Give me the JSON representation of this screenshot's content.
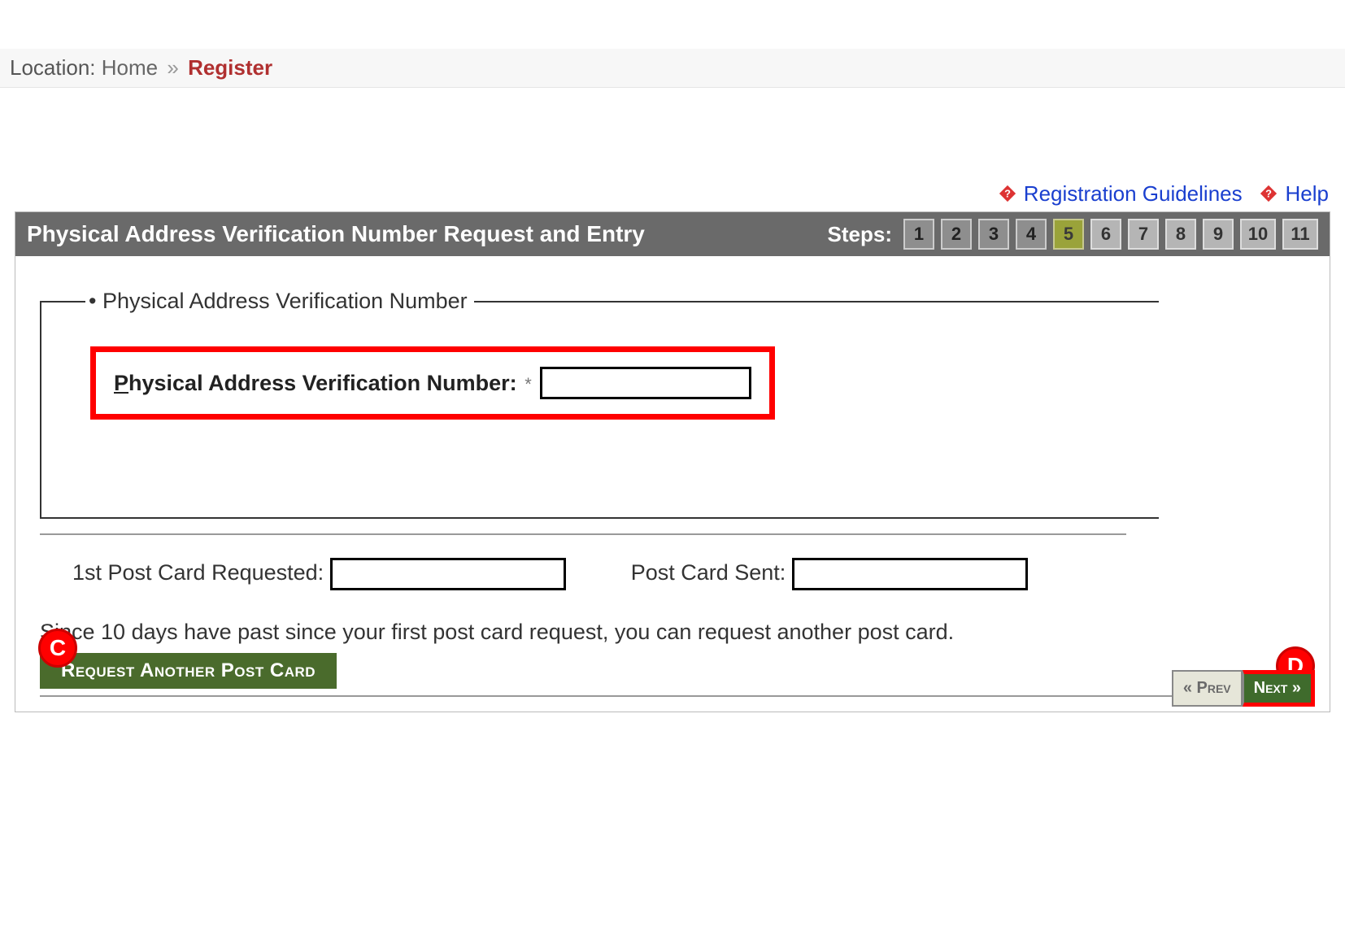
{
  "breadcrumb": {
    "location_label": "Location:",
    "home": "Home",
    "separator": "»",
    "current": "Register"
  },
  "help_links": {
    "guidelines": "Registration Guidelines",
    "help": "Help"
  },
  "panel": {
    "title": "Physical Address Verification Number Request and Entry",
    "steps_label": "Steps:",
    "steps": [
      "1",
      "2",
      "3",
      "4",
      "5",
      "6",
      "7",
      "8",
      "9",
      "10",
      "11"
    ],
    "active_step": "5"
  },
  "form": {
    "fieldset_legend": "Physical Address Verification Number",
    "verification_label_prefix": "P",
    "verification_label_rest": "hysical Address Verification Number:",
    "required_mark": "*",
    "verification_value": "",
    "first_postcard_label": "1st Post Card Requested:",
    "first_postcard_value": "",
    "postcard_sent_label": "Post Card Sent:",
    "postcard_sent_value": "",
    "info_text": "Since 10 days have past since your first post card request, you can request another post card.",
    "request_button": "Request Another Post Card"
  },
  "nav": {
    "prev": "« Prev",
    "next": "Next »"
  },
  "callouts": {
    "c": "C",
    "d": "D"
  }
}
